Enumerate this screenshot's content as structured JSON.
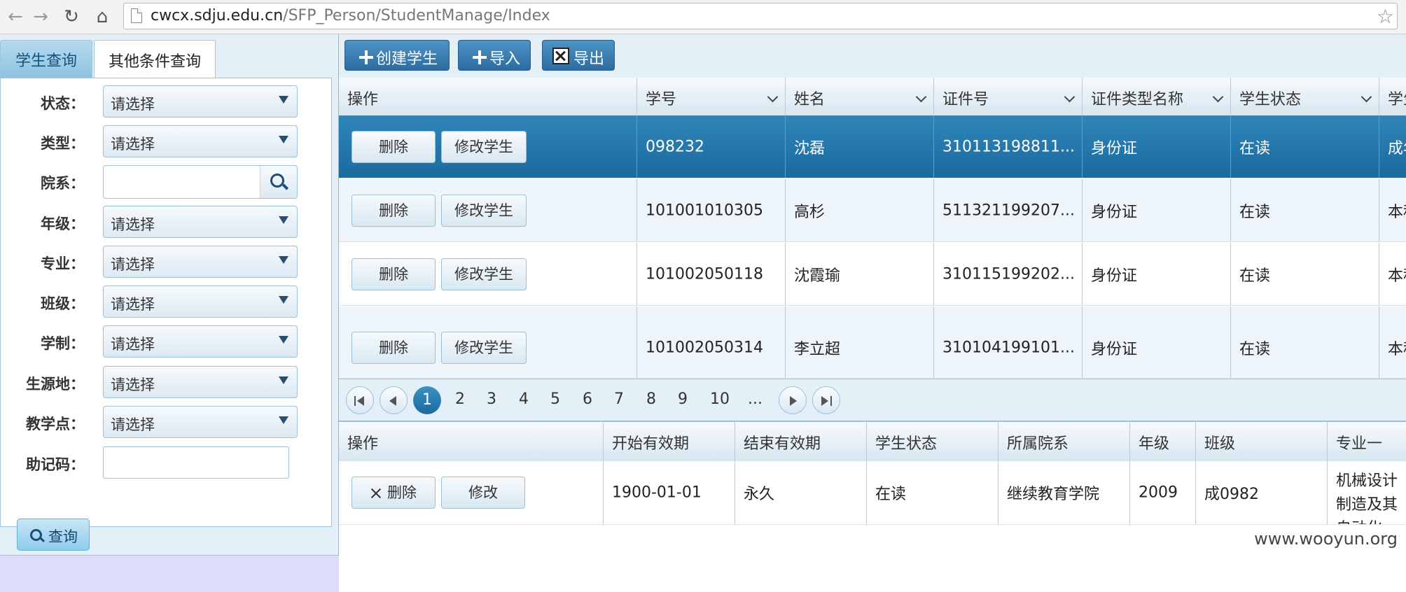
{
  "browser": {
    "url_host": "cwcx.sdju.edu.cn",
    "url_path": "/SFP_Person/StudentManage/Index"
  },
  "tabs": [
    {
      "label": "学生查询"
    },
    {
      "label": "其他条件查询"
    }
  ],
  "form": {
    "fields": [
      {
        "label": "状态：",
        "value": "请选择"
      },
      {
        "label": "类型：",
        "value": "请选择"
      },
      {
        "label": "院系：",
        "value": ""
      },
      {
        "label": "年级：",
        "value": "请选择"
      },
      {
        "label": "专业：",
        "value": "请选择"
      },
      {
        "label": "班级：",
        "value": "请选择"
      },
      {
        "label": "学制：",
        "value": "请选择"
      },
      {
        "label": "生源地：",
        "value": "请选择"
      },
      {
        "label": "教学点：",
        "value": "请选择"
      },
      {
        "label": "助记码：",
        "value": ""
      }
    ],
    "query_label": "查询"
  },
  "toolbar": {
    "create_label": "创建学生",
    "import_label": "导入",
    "export_label": "导出"
  },
  "grid": {
    "columns": [
      "操作",
      "学号",
      "姓名",
      "证件号",
      "证件类型名称",
      "学生状态",
      "学生"
    ],
    "delete_label": "删除",
    "edit_label": "修改学生",
    "rows": [
      {
        "id": "098232",
        "name": "沈磊",
        "cert": "310113198811...",
        "cert_type": "身份证",
        "status": "在读",
        "extra": "成年"
      },
      {
        "id": "101001010305",
        "name": "高杉",
        "cert": "511321199207...",
        "cert_type": "身份证",
        "status": "在读",
        "extra": "本科"
      },
      {
        "id": "101002050118",
        "name": "沈霞瑜",
        "cert": "310115199202...",
        "cert_type": "身份证",
        "status": "在读",
        "extra": "本科"
      },
      {
        "id": "101002050314",
        "name": "李立超",
        "cert": "310104199101...",
        "cert_type": "身份证",
        "status": "在读",
        "extra": "本科"
      }
    ]
  },
  "pager": {
    "current": "1",
    "pages": [
      "2",
      "3",
      "4",
      "5",
      "6",
      "7",
      "8",
      "9",
      "10",
      "..."
    ]
  },
  "detail": {
    "columns": [
      "操作",
      "开始有效期",
      "结束有效期",
      "学生状态",
      "所属院系",
      "年级",
      "班级",
      "专业一"
    ],
    "delete_label": "删除",
    "edit_label": "修改",
    "row": {
      "start": "1900-01-01",
      "end": "永久",
      "status": "在读",
      "dept": "继续教育学院",
      "grade": "2009",
      "class": "成0982",
      "major": "机械设计制造及其自动化"
    }
  },
  "watermark": "www.wooyun.org"
}
